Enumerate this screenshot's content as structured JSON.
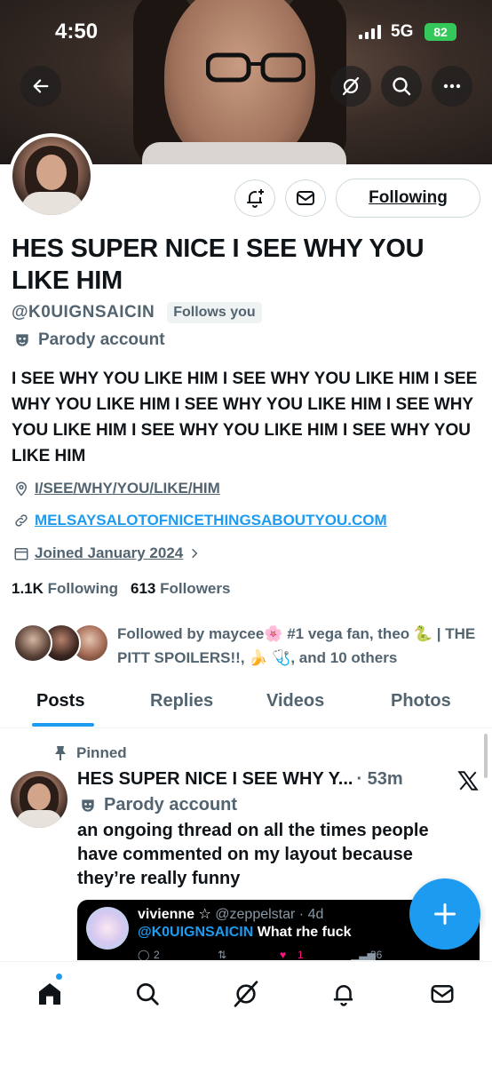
{
  "status_bar": {
    "time": "4:50",
    "network": "5G",
    "battery": "82"
  },
  "profile": {
    "display_name": "HES SUPER NICE I SEE WHY YOU LIKE HIM",
    "handle": "@K0UIGNSAICIN",
    "follows_you": "Follows you",
    "parody_label": "Parody account",
    "bio": "I SEE WHY YOU LIKE HIM I SEE WHY YOU LIKE HIM I SEE WHY YOU LIKE HIM I SEE WHY YOU LIKE HIM I SEE WHY YOU LIKE HIM I SEE WHY YOU LIKE HIM I SEE WHY YOU LIKE HIM",
    "location": "I/SEE/WHY/YOU/LIKE/HIM",
    "website": "MELSAYSALOTOFNICETHINGSABOUTYOU.COM",
    "joined": "Joined January 2024",
    "following_count": "1.1K",
    "following_label": "Following",
    "followers_count": "613",
    "followers_label": "Followers",
    "followed_by": "Followed by maycee🌸 #1 vega fan, theo 🐍 | THE PITT SPOILERS!!, 🍌 🩺, and 10 others"
  },
  "actions": {
    "follow_state": "Following"
  },
  "tabs": [
    {
      "label": "Posts",
      "active": true
    },
    {
      "label": "Replies",
      "active": false
    },
    {
      "label": "Videos",
      "active": false
    },
    {
      "label": "Photos",
      "active": false
    }
  ],
  "pinned_tweet": {
    "pinned_label": "Pinned",
    "author": "HES SUPER NICE I SEE WHY Y...",
    "time": "· 53m",
    "parody_label": "Parody account",
    "text": "an ongoing thread on all the times people have commented on my layout because they’re really funny",
    "quote": {
      "name": "vivienne ☆",
      "handle": "@zeppelstar · 4d",
      "mention": "@K0UIGNSAICIN",
      "text": "What rhe fuck",
      "reply_count": "2",
      "like_count": "1",
      "view_count": "36"
    }
  },
  "colors": {
    "accent": "#1d9bf0",
    "secondary_text": "#536471",
    "primary_text": "#0f1419",
    "battery": "#34c759"
  },
  "icons": {
    "back": "arrow-left-icon",
    "grok": "grok-icon",
    "search": "search-icon",
    "more": "more-icon",
    "notify": "bell-plus-icon",
    "message": "envelope-icon",
    "parody": "mask-icon",
    "location": "location-pin-icon",
    "link": "link-icon",
    "calendar": "calendar-icon",
    "pin": "pin-icon",
    "compose": "plus-icon",
    "nav": [
      "home-icon",
      "search-icon",
      "grok-icon",
      "bell-icon",
      "envelope-icon"
    ]
  }
}
